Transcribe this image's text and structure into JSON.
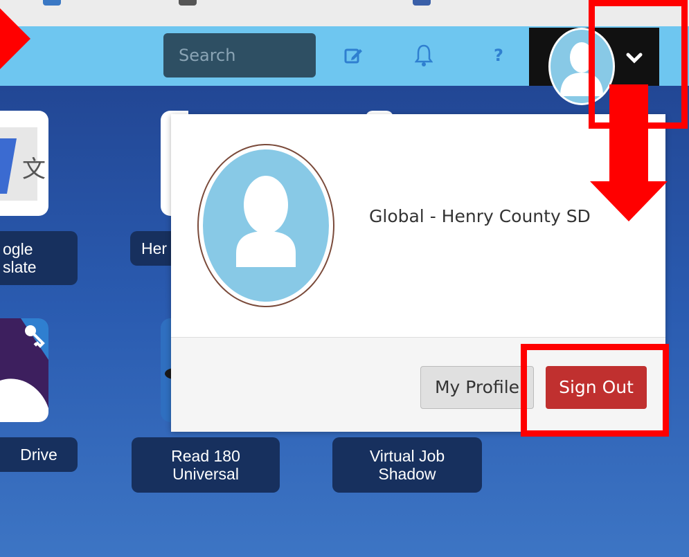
{
  "header": {
    "search_placeholder": "Search",
    "help_label": "?"
  },
  "tiles": {
    "google_translate_label": "ogle\nslate",
    "hero_partial_label": "Her",
    "drive_label": "Drive",
    "read180_label": "Read 180\nUniversal",
    "vjs_label": "Virtual Job\nShadow"
  },
  "account_menu": {
    "org_name": "Global - Henry County SD",
    "my_profile_label": "My Profile",
    "sign_out_label": "Sign Out"
  },
  "colors": {
    "header_bg": "#6ec6f0",
    "sign_out": "#c0302f",
    "annotation": "#ff0000"
  }
}
